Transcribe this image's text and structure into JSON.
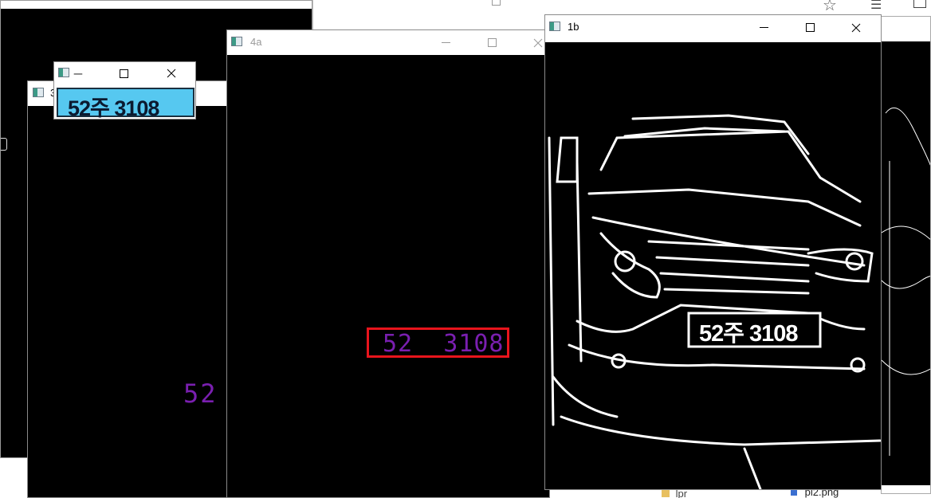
{
  "windows": {
    "bg_top": {
      "title": ""
    },
    "w3": {
      "title": "3",
      "side_text": "52"
    },
    "w_plate": {
      "title": "ㅡ",
      "plate_text": "52주 3108"
    },
    "w4a": {
      "title": "4a",
      "detected_text": "52  3108"
    },
    "w1b": {
      "title": "1b",
      "plate_text": "52주 3108"
    },
    "explorer": {
      "item1": "lpr",
      "item2": "pl2.png"
    }
  },
  "colors": {
    "detect_box": "#e8141c",
    "purple_text": "#7a1fb0",
    "plate_blue": "#56c8f0"
  }
}
